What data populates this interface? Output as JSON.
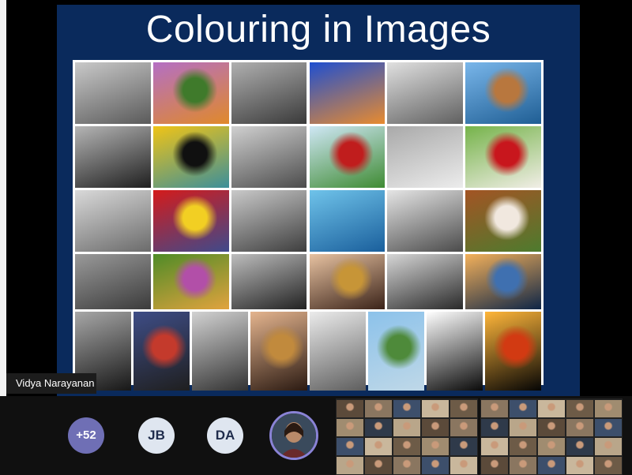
{
  "slide": {
    "title": "Colouring in Images",
    "grid_rows": [
      {
        "tiles": [
          {
            "name": "thistle-butterfly-grayscale",
            "colors": [
              "#c9c9c9",
              "#5a5a5a"
            ]
          },
          {
            "name": "thistle-butterfly-color",
            "colors": [
              "#b46fc4",
              "#3f7a2b",
              "#e0892a"
            ]
          },
          {
            "name": "jellyfish-grayscale",
            "colors": [
              "#b0b0b0",
              "#3a3a3a"
            ]
          },
          {
            "name": "jellyfish-color",
            "colors": [
              "#1f4fd0",
              "#e88b2f"
            ]
          },
          {
            "name": "coastal-cliffs-grayscale",
            "colors": [
              "#e0e0e0",
              "#606060"
            ]
          },
          {
            "name": "coastal-cliffs-color",
            "colors": [
              "#79b6ea",
              "#b8773e",
              "#1f5e94"
            ]
          }
        ]
      },
      {
        "tiles": [
          {
            "name": "angelfish-grayscale",
            "colors": [
              "#b5b5b5",
              "#1f1f1f"
            ]
          },
          {
            "name": "angelfish-color",
            "colors": [
              "#f0c416",
              "#101010",
              "#3c8f9a"
            ]
          },
          {
            "name": "sports-car-grayscale",
            "colors": [
              "#d0d0d0",
              "#4c4c4c"
            ]
          },
          {
            "name": "sports-car-color",
            "colors": [
              "#cfe7f5",
              "#c01d1d",
              "#3f8b33"
            ]
          },
          {
            "name": "rooster-grayscale",
            "colors": [
              "#a9a9a9",
              "#ececec"
            ]
          },
          {
            "name": "rooster-color",
            "colors": [
              "#75b34a",
              "#c8161d",
              "#f1eee6"
            ]
          }
        ]
      },
      {
        "tiles": [
          {
            "name": "eggs-bowl-grayscale",
            "colors": [
              "#d9d9d9",
              "#6b6b6b"
            ]
          },
          {
            "name": "eggs-bowl-color",
            "colors": [
              "#d41b1b",
              "#f2cf23",
              "#3f4a8b"
            ]
          },
          {
            "name": "swimming-pool-grayscale",
            "colors": [
              "#c9c9c9",
              "#3e3e3e"
            ]
          },
          {
            "name": "swimming-pool-color",
            "colors": [
              "#6fc3ea",
              "#1a5f9c"
            ]
          },
          {
            "name": "spaniel-grayscale",
            "colors": [
              "#e5e5e5",
              "#4b4b4b"
            ]
          },
          {
            "name": "spaniel-color",
            "colors": [
              "#a35424",
              "#f1e8df",
              "#4d7b2e"
            ]
          }
        ]
      },
      {
        "tiles": [
          {
            "name": "croquet-grayscale",
            "colors": [
              "#9a9a9a",
              "#3b3b3b"
            ]
          },
          {
            "name": "croquet-color",
            "colors": [
              "#4f8b27",
              "#b24fa8",
              "#e1a33e"
            ]
          },
          {
            "name": "trumpet-player-grayscale",
            "colors": [
              "#bdbdbd",
              "#222222"
            ]
          },
          {
            "name": "trumpet-player-color",
            "colors": [
              "#e7c2a1",
              "#c79537",
              "#3b2319"
            ]
          },
          {
            "name": "seascape-grayscale",
            "colors": [
              "#d6d6d6",
              "#2a2a2a"
            ]
          },
          {
            "name": "seascape-color",
            "colors": [
              "#f4b15b",
              "#3f70b0",
              "#0e2546"
            ]
          }
        ]
      },
      {
        "tiles": [
          {
            "name": "ceremony-grayscale",
            "colors": [
              "#a7a7a7",
              "#171717"
            ]
          },
          {
            "name": "ceremony-color",
            "colors": [
              "#3e4d86",
              "#c43a2c",
              "#1f1f1f"
            ]
          },
          {
            "name": "panpipe-player-grayscale",
            "colors": [
              "#d2d2d2",
              "#333333"
            ]
          },
          {
            "name": "panpipe-player-color",
            "colors": [
              "#e4b48e",
              "#c18a3d",
              "#2b1a12"
            ]
          },
          {
            "name": "mountain-hiker-grayscale",
            "colors": [
              "#ebebeb",
              "#5e5e5e"
            ]
          },
          {
            "name": "mountain-hiker-color",
            "colors": [
              "#8cc2ea",
              "#4e8a3a",
              "#bfd8e8"
            ]
          },
          {
            "name": "candle-grayscale",
            "colors": [
              "#ffffff",
              "#0a0a0a"
            ]
          },
          {
            "name": "candle-color",
            "colors": [
              "#ffb63a",
              "#d23a12",
              "#050505"
            ]
          }
        ]
      }
    ]
  },
  "speaker": {
    "name": "Vidya Narayanan"
  },
  "participants": {
    "more_count": "+52",
    "initials": [
      "JB",
      "DA"
    ]
  },
  "gallery_colors": [
    "#5b4a3a",
    "#8a7660",
    "#3d4f6b",
    "#c9b79c",
    "#6d5b47",
    "#a08c70",
    "#2f3a4a",
    "#b9a68a"
  ]
}
